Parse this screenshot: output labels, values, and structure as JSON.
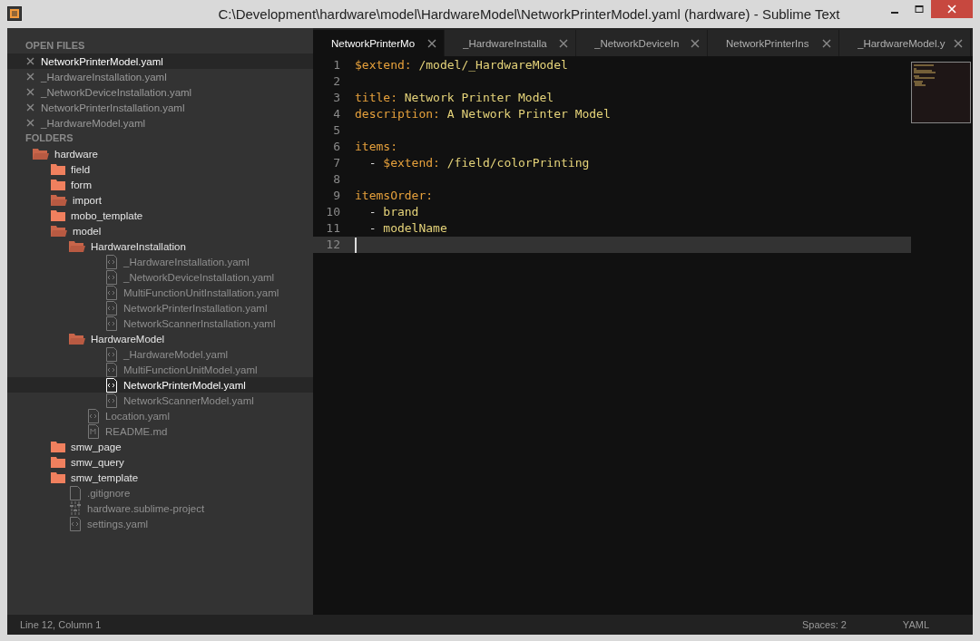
{
  "window": {
    "title": "C:\\Development\\hardware\\model\\HardwareModel\\NetworkPrinterModel.yaml (hardware) - Sublime Text"
  },
  "sidebar": {
    "open_files_header": "OPEN FILES",
    "open_files": [
      {
        "label": "NetworkPrinterModel.yaml",
        "selected": true
      },
      {
        "label": "_HardwareInstallation.yaml",
        "selected": false
      },
      {
        "label": "_NetworkDeviceInstallation.yaml",
        "selected": false
      },
      {
        "label": "NetworkPrinterInstallation.yaml",
        "selected": false
      },
      {
        "label": "_HardwareModel.yaml",
        "selected": false
      }
    ],
    "folders_header": "FOLDERS",
    "tree": [
      {
        "kind": "folder",
        "label": "hardware",
        "expanded": true,
        "selected": false,
        "children": [
          {
            "kind": "folder",
            "label": "field",
            "expanded": false,
            "selected": false
          },
          {
            "kind": "folder",
            "label": "form",
            "expanded": false,
            "selected": false
          },
          {
            "kind": "folder",
            "label": "import",
            "expanded": true,
            "selected": false
          },
          {
            "kind": "folder",
            "label": "mobo_template",
            "expanded": false,
            "selected": false
          },
          {
            "kind": "folder",
            "label": "model",
            "expanded": true,
            "selected": false,
            "children": [
              {
                "kind": "folder",
                "label": "HardwareInstallation",
                "expanded": true,
                "selected": false,
                "children": [
                  {
                    "kind": "code",
                    "label": "_HardwareInstallation.yaml",
                    "selected": false
                  },
                  {
                    "kind": "code",
                    "label": "_NetworkDeviceInstallation.yaml",
                    "selected": false
                  },
                  {
                    "kind": "code",
                    "label": "MultiFunctionUnitInstallation.yaml",
                    "selected": false
                  },
                  {
                    "kind": "code",
                    "label": "NetworkPrinterInstallation.yaml",
                    "selected": false
                  },
                  {
                    "kind": "code",
                    "label": "NetworkScannerInstallation.yaml",
                    "selected": false
                  }
                ]
              },
              {
                "kind": "folder",
                "label": "HardwareModel",
                "expanded": true,
                "selected": false,
                "children": [
                  {
                    "kind": "code",
                    "label": "_HardwareModel.yaml",
                    "selected": false
                  },
                  {
                    "kind": "code",
                    "label": "MultiFunctionUnitModel.yaml",
                    "selected": false
                  },
                  {
                    "kind": "code",
                    "label": "NetworkPrinterModel.yaml",
                    "selected": true
                  },
                  {
                    "kind": "code",
                    "label": "NetworkScannerModel.yaml",
                    "selected": false
                  }
                ]
              },
              {
                "kind": "code",
                "label": "Location.yaml",
                "selected": false
              },
              {
                "kind": "markdown",
                "label": "README.md",
                "selected": false
              }
            ]
          },
          {
            "kind": "folder",
            "label": "smw_page",
            "expanded": false,
            "selected": false
          },
          {
            "kind": "folder",
            "label": "smw_query",
            "expanded": false,
            "selected": false
          },
          {
            "kind": "folder",
            "label": "smw_template",
            "expanded": false,
            "selected": false
          },
          {
            "kind": "plain",
            "label": ".gitignore",
            "selected": false
          },
          {
            "kind": "project",
            "label": "hardware.sublime-project",
            "selected": false
          },
          {
            "kind": "code",
            "label": "settings.yaml",
            "selected": false
          }
        ]
      }
    ]
  },
  "tabs": [
    {
      "label": "NetworkPrinterMo",
      "selected": true
    },
    {
      "label": "_HardwareInstalla",
      "selected": false
    },
    {
      "label": "_NetworkDeviceIn",
      "selected": false
    },
    {
      "label": "NetworkPrinterIns",
      "selected": false
    },
    {
      "label": "_HardwareModel.y",
      "selected": false
    }
  ],
  "editor": {
    "lines": [
      {
        "number": "1",
        "current": false,
        "tokens": [
          {
            "kind": "key",
            "text": "$extend:"
          },
          {
            "kind": "value",
            "text": " /model/_HardwareModel"
          }
        ]
      },
      {
        "number": "2",
        "current": false
      },
      {
        "number": "3",
        "current": false,
        "tokens": [
          {
            "kind": "key",
            "text": "title:"
          },
          {
            "kind": "value",
            "text": " Network Printer Model"
          }
        ]
      },
      {
        "number": "4",
        "current": false,
        "tokens": [
          {
            "kind": "key",
            "text": "description:"
          },
          {
            "kind": "value",
            "text": " A Network Printer Model"
          }
        ]
      },
      {
        "number": "5",
        "current": false
      },
      {
        "number": "6",
        "current": false,
        "tokens": [
          {
            "kind": "key",
            "text": "items:"
          }
        ]
      },
      {
        "number": "7",
        "current": false,
        "tokens": [
          {
            "kind": "plain",
            "text": "  - "
          },
          {
            "kind": "key",
            "text": "$extend:"
          },
          {
            "kind": "value",
            "text": " /field/colorPrinting"
          }
        ]
      },
      {
        "number": "8",
        "current": false
      },
      {
        "number": "9",
        "current": false,
        "tokens": [
          {
            "kind": "key",
            "text": "itemsOrder:"
          }
        ]
      },
      {
        "number": "10",
        "current": false,
        "tokens": [
          {
            "kind": "plain",
            "text": "  - "
          },
          {
            "kind": "value",
            "text": "brand"
          }
        ]
      },
      {
        "number": "11",
        "current": false,
        "tokens": [
          {
            "kind": "plain",
            "text": "  - "
          },
          {
            "kind": "value",
            "text": "modelName"
          }
        ]
      },
      {
        "number": "12",
        "current": true
      }
    ]
  },
  "status_bar": {
    "position": "Line 12, Column 1",
    "indentation": "Spaces: 2",
    "syntax": "YAML"
  }
}
